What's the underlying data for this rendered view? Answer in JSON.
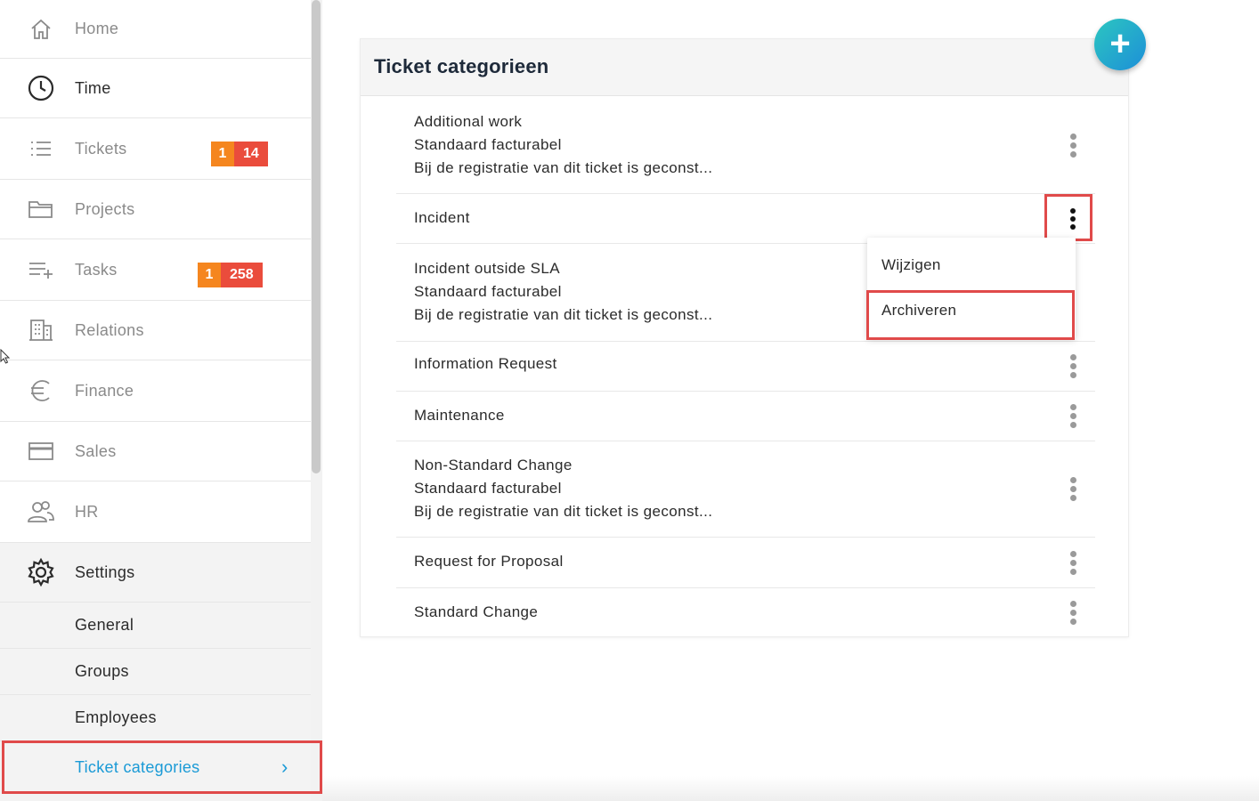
{
  "sidebar": {
    "items": [
      {
        "label": "Home",
        "icon": "home-icon"
      },
      {
        "label": "Time",
        "icon": "clock-icon"
      },
      {
        "label": "Tickets",
        "icon": "list-icon",
        "badge_primary": "1",
        "badge_secondary": "14"
      },
      {
        "label": "Projects",
        "icon": "folder-icon"
      },
      {
        "label": "Tasks",
        "icon": "task-list-icon",
        "badge_primary": "1",
        "badge_secondary": "258"
      },
      {
        "label": "Relations",
        "icon": "building-icon"
      },
      {
        "label": "Finance",
        "icon": "euro-icon"
      },
      {
        "label": "Sales",
        "icon": "card-icon"
      },
      {
        "label": "HR",
        "icon": "people-icon"
      },
      {
        "label": "Settings",
        "icon": "gear-icon"
      }
    ],
    "settings_sub": [
      {
        "label": "General"
      },
      {
        "label": "Groups"
      },
      {
        "label": "Employees"
      },
      {
        "label": "Ticket categories",
        "current": true
      }
    ],
    "chevron": "›"
  },
  "main": {
    "title": "Ticket categorieen",
    "add_button": "+",
    "categories": [
      {
        "name": "Additional work",
        "billing": "Standaard facturabel",
        "note": "Bij de registratie van dit ticket is geconst..."
      },
      {
        "name": "Incident"
      },
      {
        "name": "Incident outside SLA",
        "billing": "Standaard facturabel",
        "note": "Bij de registratie van dit ticket is geconst..."
      },
      {
        "name": "Information Request"
      },
      {
        "name": "Maintenance"
      },
      {
        "name": "Non-Standard Change",
        "billing": "Standaard facturabel",
        "note": "Bij de registratie van dit ticket is geconst..."
      },
      {
        "name": "Request for Proposal"
      },
      {
        "name": "Standard Change"
      }
    ],
    "context_menu": {
      "edit": "Wijzigen",
      "archive": "Archiveren"
    }
  },
  "colors": {
    "accent": "#1a9ad6",
    "badge_orange": "#f5861f",
    "badge_red": "#ea4c3c",
    "highlight": "#e04a4a"
  }
}
